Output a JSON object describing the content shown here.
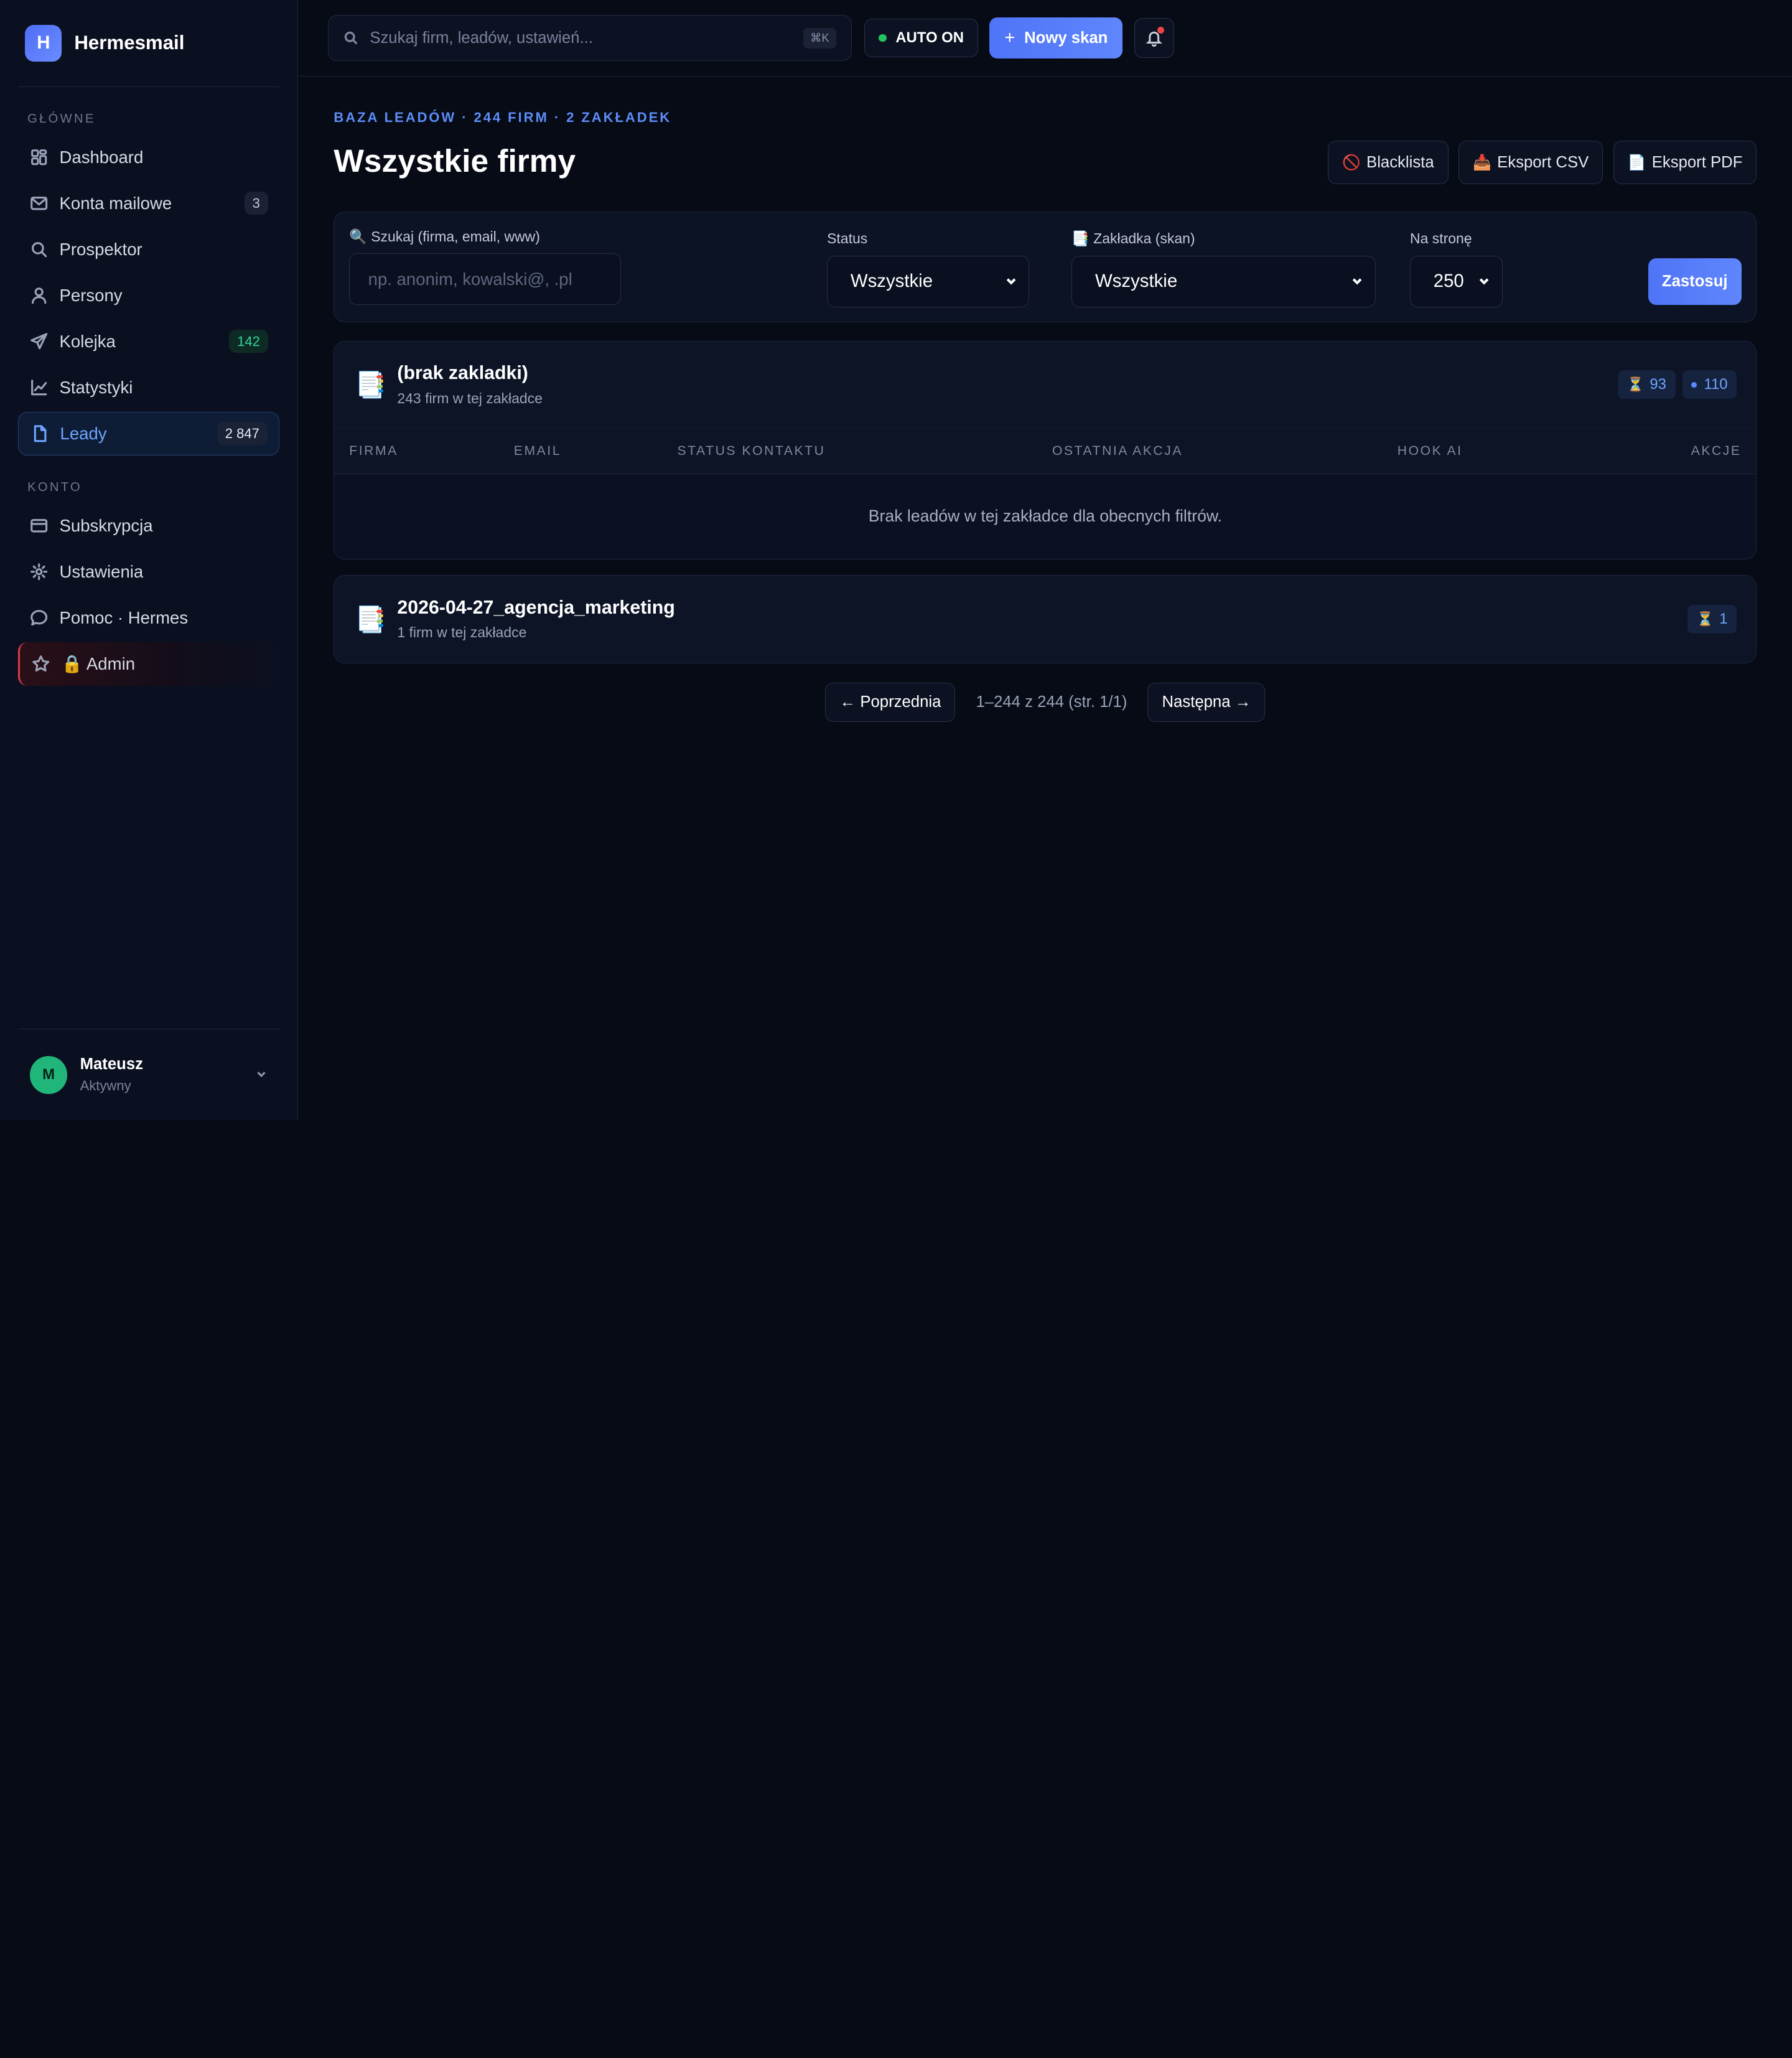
{
  "brand": {
    "logo_letter": "H",
    "name": "Hermesmail"
  },
  "sidebar": {
    "section_main": "GŁÓWNE",
    "section_account": "KONTO",
    "main_items": [
      {
        "label": "Dashboard",
        "icon": "dashboard-icon"
      },
      {
        "label": "Konta mailowe",
        "icon": "mail-icon",
        "badge": "3"
      },
      {
        "label": "Prospektor",
        "icon": "search-icon"
      },
      {
        "label": "Persony",
        "icon": "user-icon"
      },
      {
        "label": "Kolejka",
        "icon": "send-icon",
        "badge": "142"
      },
      {
        "label": "Statystyki",
        "icon": "chart-icon"
      },
      {
        "label": "Leady",
        "icon": "file-icon",
        "badge": "2 847",
        "active": true
      }
    ],
    "account_items": [
      {
        "label": "Subskrypcja",
        "icon": "credit-card-icon"
      },
      {
        "label": "Ustawienia",
        "icon": "gear-icon"
      },
      {
        "label": "Pomoc · Hermes",
        "icon": "chat-icon"
      },
      {
        "label": "🔒 Admin",
        "icon": "star-icon"
      }
    ],
    "user": {
      "initial": "M",
      "name": "Mateusz",
      "status": "Aktywny"
    }
  },
  "topbar": {
    "search_placeholder": "Szukaj firm, leadów, ustawień...",
    "shortcut": "⌘K",
    "auto_label": "AUTO ON",
    "new_scan_label": "Nowy skan"
  },
  "page": {
    "eyebrow": "BAZA LEADÓW · 244 FIRM · 2 ZAKŁADEK",
    "title": "Wszystkie firmy",
    "actions": [
      {
        "icon": "🚫",
        "label": "Blacklista"
      },
      {
        "icon": "📥",
        "label": "Eksport CSV"
      },
      {
        "icon": "📄",
        "label": "Eksport PDF"
      }
    ]
  },
  "filters": {
    "search_label": "🔍 Szukaj (firma, email, www)",
    "search_placeholder": "np. anonim, kowalski@, .pl",
    "status_label": "Status",
    "status_value": "Wszystkie",
    "tab_label": "📑 Zakładka (skan)",
    "tab_value": "Wszystkie",
    "per_page_label": "Na stronę",
    "per_page_value": "250",
    "apply_label": "Zastosuj"
  },
  "groups": [
    {
      "icon": "📑",
      "name": "(brak zakladki)",
      "subtitle": "243 firm w tej zakładce",
      "badges": [
        {
          "icon": "⏳",
          "value": "93"
        },
        {
          "dot": true,
          "value": "110"
        }
      ],
      "columns": [
        "FIRMA",
        "EMAIL",
        "STATUS KONTAKTU",
        "OSTATNIA AKCJA",
        "HOOK AI",
        "AKCJE"
      ],
      "empty_text": "Brak leadów w tej zakładce dla obecnych filtrów."
    },
    {
      "icon": "📑",
      "name": "2026-04-27_agencja_marketing",
      "subtitle": "1 firm w tej zakładce",
      "badges": [
        {
          "icon": "⏳",
          "value": "1"
        }
      ]
    }
  ],
  "pagination": {
    "prev_label": "← Poprzednia",
    "info": "1–244 z 244 (str. 1/1)",
    "next_label": "Następna →"
  },
  "colors": {
    "accent": "#5b86fb",
    "active_text": "#6ea5ff",
    "status_on": "#22c55e",
    "admin_border": "#e23a4e"
  }
}
